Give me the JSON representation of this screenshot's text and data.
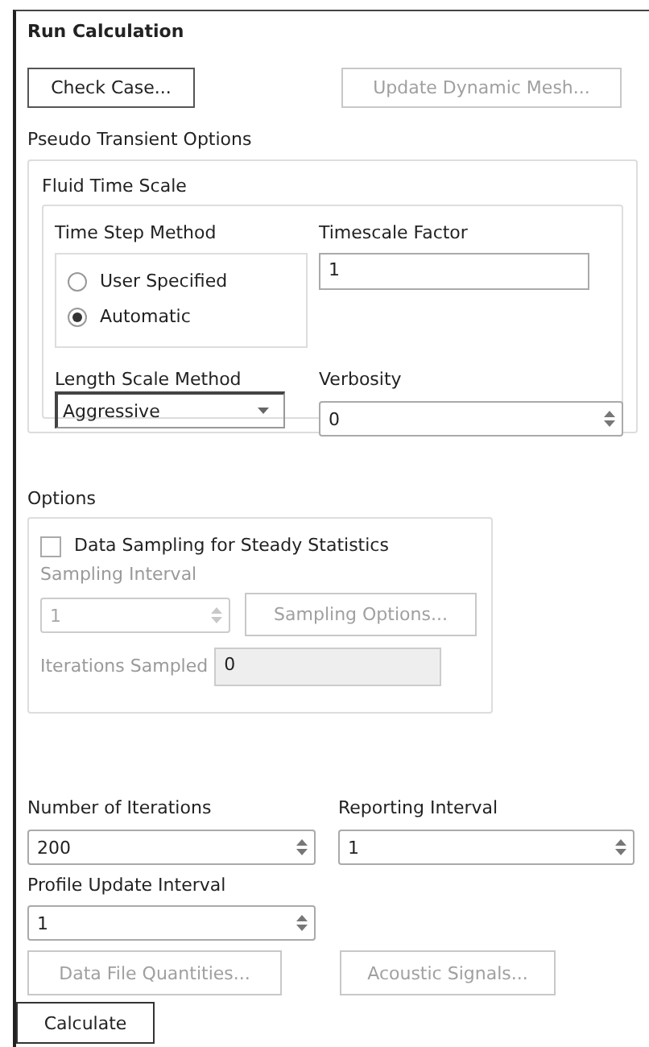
{
  "panel": {
    "title": "Run Calculation"
  },
  "top_buttons": [
    {
      "label": "Check Case...",
      "disabled": false
    },
    {
      "label": "Update Dynamic Mesh...",
      "disabled": true
    }
  ],
  "pseudo_transient": {
    "label": "Pseudo Transient Options",
    "group_label": "Fluid Time Scale",
    "time_step_method": {
      "label": "Time Step Method",
      "options": [
        {
          "label": "User Specified",
          "selected": false
        },
        {
          "label": "Automatic",
          "selected": true
        }
      ]
    },
    "timescale_factor": {
      "label": "Timescale Factor",
      "value": "1"
    },
    "length_scale_method": {
      "label": "Length Scale Method",
      "value": "Aggressive"
    },
    "verbosity": {
      "label": "Verbosity",
      "value": "0"
    }
  },
  "options": {
    "label": "Options",
    "data_sampling": {
      "label": "Data Sampling for Steady Statistics",
      "checked": false
    },
    "sampling_interval": {
      "label": "Sampling Interval",
      "value": "1",
      "disabled": true
    },
    "sampling_options_button": {
      "label": "Sampling Options...",
      "disabled": true
    },
    "iterations_sampled": {
      "label": "Iterations Sampled",
      "value": "0",
      "disabled": true
    }
  },
  "number_of_iterations": {
    "label": "Number of Iterations",
    "value": "200"
  },
  "reporting_interval": {
    "label": "Reporting Interval",
    "value": "1"
  },
  "profile_update_interval": {
    "label": "Profile Update Interval",
    "value": "1"
  },
  "bottom_buttons": [
    {
      "label": "Data File Quantities...",
      "disabled": true
    },
    {
      "label": "Acoustic Signals...",
      "disabled": true
    }
  ],
  "calculate_button": {
    "label": "Calculate"
  }
}
